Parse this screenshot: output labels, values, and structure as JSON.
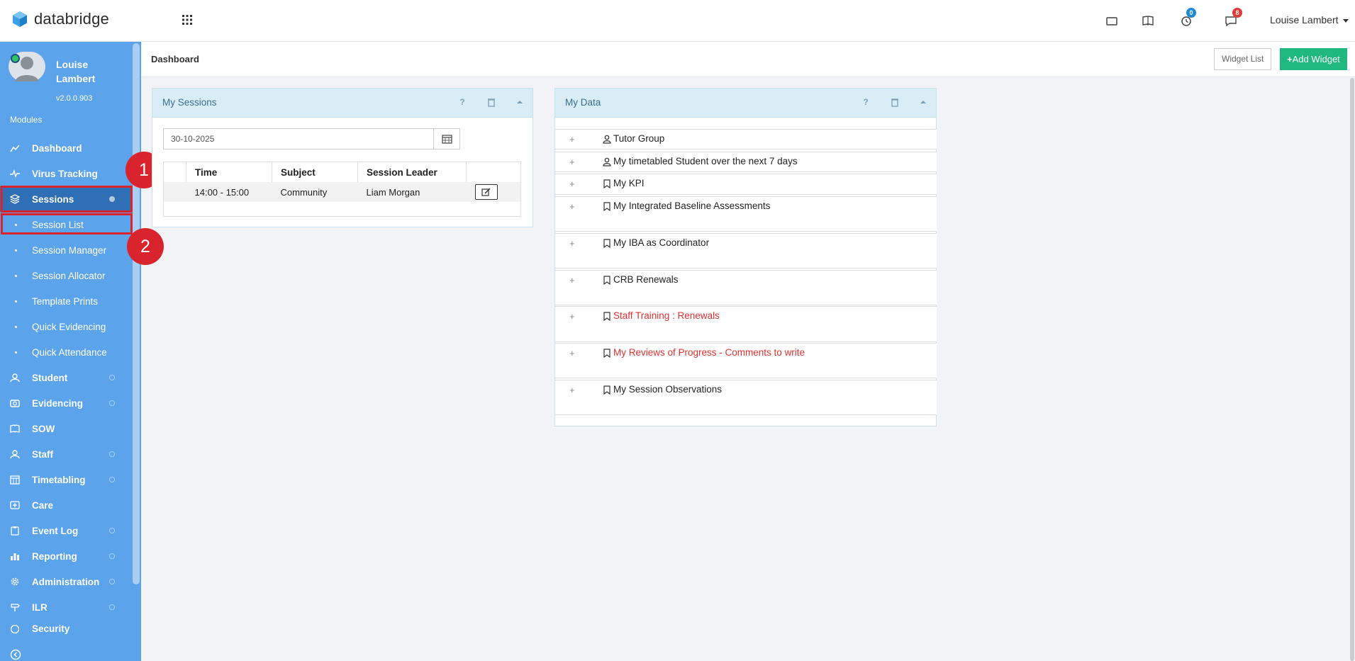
{
  "app": {
    "name": "databridge"
  },
  "topbar": {
    "user_name": "Louise Lambert",
    "icons": [
      "monitor-icon",
      "book-icon",
      "clock-icon",
      "chat-icon"
    ],
    "clock_badge": "0",
    "chat_badge": "8",
    "colors": {
      "clock_badge": "#1a8ad9",
      "chat_badge": "#e53935"
    }
  },
  "sidebar": {
    "profile": {
      "name": "Louise Lambert",
      "version": "v2.0.0.903"
    },
    "modules_label": "Modules",
    "items": [
      {
        "label": "Dashboard",
        "icon": "chart-line-icon"
      },
      {
        "label": "Virus Tracking",
        "icon": "pulse-icon"
      },
      {
        "label": "Sessions",
        "icon": "layers-icon",
        "active": true
      },
      {
        "label": "Student",
        "icon": "user-icon"
      },
      {
        "label": "Evidencing",
        "icon": "camera-icon"
      },
      {
        "label": "SOW",
        "icon": "book-open-icon"
      },
      {
        "label": "Staff",
        "icon": "user-icon"
      },
      {
        "label": "Timetabling",
        "icon": "calendar-icon"
      },
      {
        "label": "Care",
        "icon": "care-icon"
      },
      {
        "label": "Event Log",
        "icon": "clipboard-icon"
      },
      {
        "label": "Reporting",
        "icon": "bar-chart-icon"
      },
      {
        "label": "Administration",
        "icon": "gear-icon"
      },
      {
        "label": "ILR",
        "icon": "signpost-icon"
      },
      {
        "label": "Security",
        "icon": "globe-icon"
      }
    ],
    "sessions_sub": [
      "Session List",
      "Session Manager",
      "Session Allocator",
      "Template Prints",
      "Quick Evidencing",
      "Quick Attendance"
    ],
    "markers": [
      "1",
      "2"
    ],
    "colors": {
      "bg": "#5ba3ea",
      "active": "#2f6fb5",
      "highlight": "#d9232d"
    }
  },
  "header": {
    "title": "Dashboard",
    "widget_list_label": "Widget List",
    "add_widget_label": "Add Widget"
  },
  "my_sessions": {
    "title": "My Sessions",
    "date_value": "30-10-2025",
    "columns": [
      "Time",
      "Subject",
      "Session Leader"
    ],
    "rows": [
      {
        "time": "14:00 - 15:00",
        "subject": "Community",
        "leader": "Liam Morgan"
      }
    ]
  },
  "my_data": {
    "title": "My Data",
    "rows": [
      {
        "label": "Tutor Group",
        "icon": "user-icon",
        "red": false
      },
      {
        "label": "My timetabled Student over the next 7 days",
        "icon": "user-icon",
        "red": false
      },
      {
        "label": "My KPI",
        "icon": "bookmark-icon",
        "red": false
      },
      {
        "label": "My Integrated Baseline Assessments",
        "icon": "bookmark-icon",
        "red": false
      },
      {
        "label": "My IBA as Coordinator",
        "icon": "bookmark-icon",
        "red": false
      },
      {
        "label": "CRB Renewals",
        "icon": "bookmark-icon",
        "red": false
      },
      {
        "label": "Staff Training : Renewals",
        "icon": "bookmark-icon",
        "red": true
      },
      {
        "label": "My Reviews of Progress - Comments to write",
        "icon": "bookmark-icon",
        "red": true
      },
      {
        "label": "My Session Observations",
        "icon": "bookmark-icon",
        "red": false
      }
    ]
  }
}
